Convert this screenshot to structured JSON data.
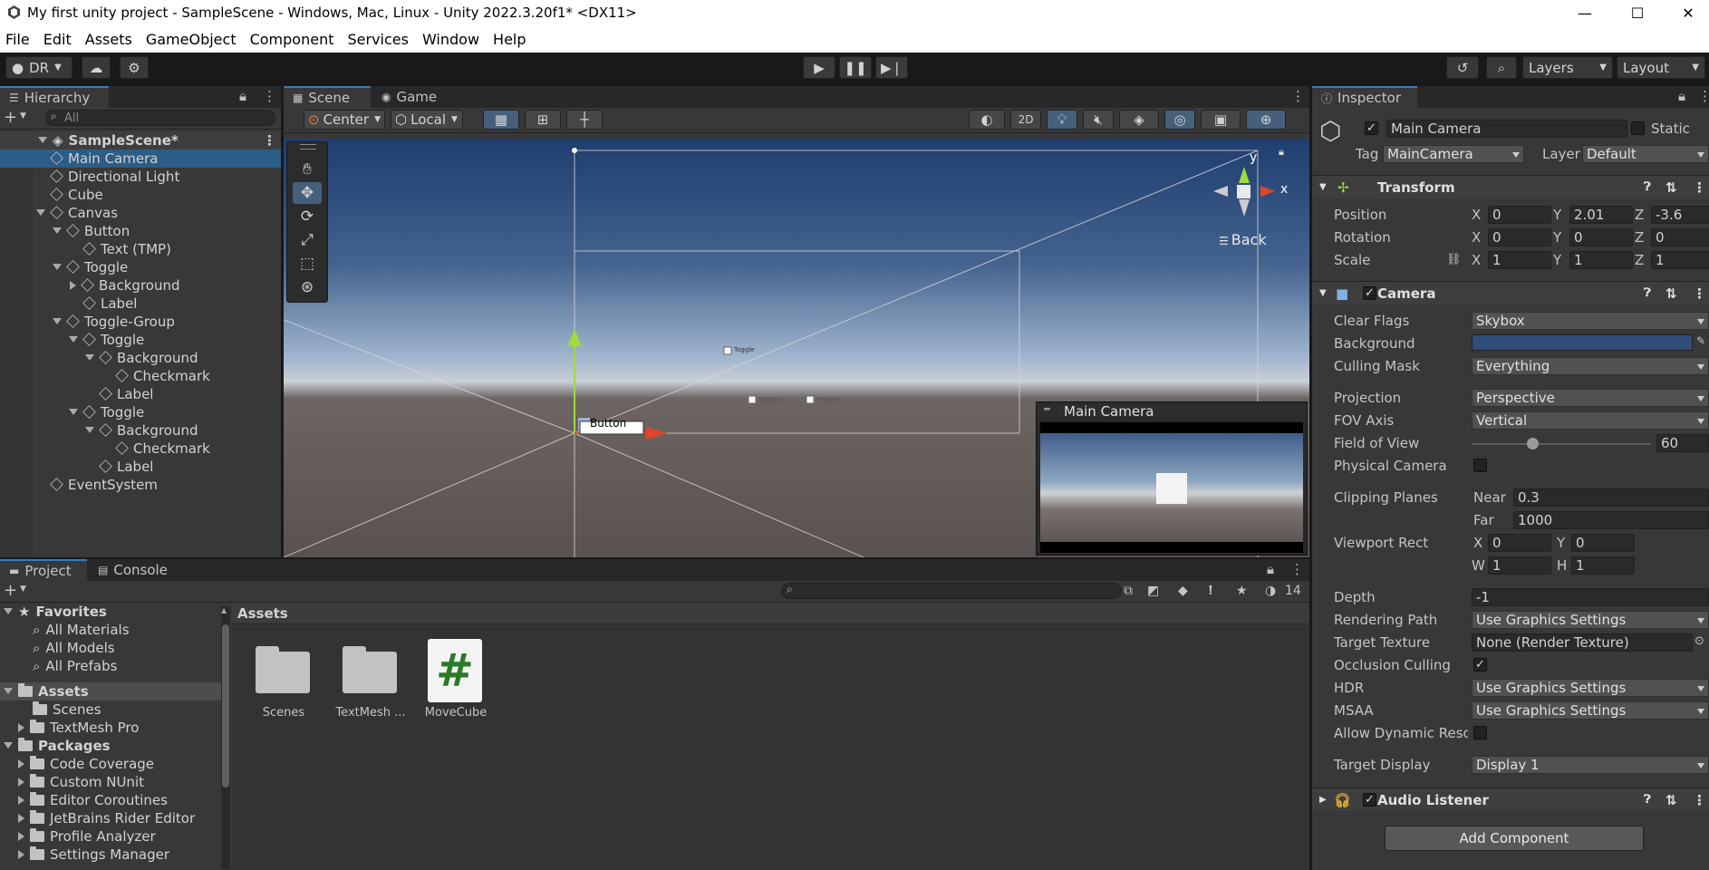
{
  "window": {
    "title": "My first unity project - SampleScene - Windows, Mac, Linux - Unity 2022.3.20f1* <DX11>"
  },
  "menu": [
    "File",
    "Edit",
    "Assets",
    "GameObject",
    "Component",
    "Services",
    "Window",
    "Help"
  ],
  "toolbar": {
    "account": "DR",
    "layers": "Layers",
    "layout": "Layout"
  },
  "hierarchy": {
    "tab": "Hierarchy",
    "search_placeholder": "All",
    "scene": "SampleScene*",
    "items": [
      {
        "label": "Main Camera",
        "depth": 1,
        "expand": "",
        "selected": true
      },
      {
        "label": "Directional Light",
        "depth": 1,
        "expand": ""
      },
      {
        "label": "Cube",
        "depth": 1,
        "expand": ""
      },
      {
        "label": "Canvas",
        "depth": 1,
        "expand": "open"
      },
      {
        "label": "Button",
        "depth": 2,
        "expand": "open"
      },
      {
        "label": "Text (TMP)",
        "depth": 3,
        "expand": ""
      },
      {
        "label": "Toggle",
        "depth": 2,
        "expand": "open"
      },
      {
        "label": "Background",
        "depth": 3,
        "expand": "closed"
      },
      {
        "label": "Label",
        "depth": 3,
        "expand": ""
      },
      {
        "label": "Toggle-Group",
        "depth": 2,
        "expand": "open"
      },
      {
        "label": "Toggle",
        "depth": 3,
        "expand": "open"
      },
      {
        "label": "Background",
        "depth": 4,
        "expand": "open"
      },
      {
        "label": "Checkmark",
        "depth": 5,
        "expand": ""
      },
      {
        "label": "Label",
        "depth": 4,
        "expand": ""
      },
      {
        "label": "Toggle",
        "depth": 3,
        "expand": "open"
      },
      {
        "label": "Background",
        "depth": 4,
        "expand": "open"
      },
      {
        "label": "Checkmark",
        "depth": 5,
        "expand": ""
      },
      {
        "label": "Label",
        "depth": 4,
        "expand": ""
      },
      {
        "label": "EventSystem",
        "depth": 1,
        "expand": ""
      }
    ]
  },
  "scene": {
    "tabs": [
      "Scene",
      "Game"
    ],
    "pivot": "Center",
    "space": "Local",
    "mode2d": "2D",
    "view_label": "Back",
    "button_label": "Button",
    "toggle_label": "Toggle",
    "toggle1": "Toggle1",
    "toggle2": "Toggle2",
    "axis_x": "x",
    "axis_y": "y",
    "preview_title": "Main Camera"
  },
  "project": {
    "tabs": [
      "Project",
      "Console"
    ],
    "hidden_count": "14",
    "favorites": {
      "label": "Favorites",
      "items": [
        "All Materials",
        "All Models",
        "All Prefabs"
      ]
    },
    "assets_root": {
      "label": "Assets",
      "items": [
        {
          "label": "Scenes",
          "expand": ""
        },
        {
          "label": "TextMesh Pro",
          "expand": "closed"
        }
      ]
    },
    "packages": {
      "label": "Packages",
      "items": [
        "Code Coverage",
        "Custom NUnit",
        "Editor Coroutines",
        "JetBrains Rider Editor",
        "Profile Analyzer",
        "Settings Manager"
      ]
    },
    "breadcrumb": "Assets",
    "grid": [
      {
        "label": "Scenes",
        "type": "folder"
      },
      {
        "label": "TextMesh ...",
        "type": "folder"
      },
      {
        "label": "MoveCube",
        "type": "script"
      }
    ]
  },
  "inspector": {
    "tab": "Inspector",
    "name": "Main Camera",
    "static": "Static",
    "tag_label": "Tag",
    "tag": "MainCamera",
    "layer_label": "Layer",
    "layer": "Default",
    "transform": {
      "title": "Transform",
      "position": {
        "label": "Position",
        "x": "0",
        "y": "2.01",
        "z": "-3.6"
      },
      "rotation": {
        "label": "Rotation",
        "x": "0",
        "y": "0",
        "z": "0"
      },
      "scale": {
        "label": "Scale",
        "x": "1",
        "y": "1",
        "z": "1"
      }
    },
    "camera": {
      "title": "Camera",
      "clear_flags": {
        "label": "Clear Flags",
        "value": "Skybox"
      },
      "background": {
        "label": "Background",
        "color": "#314d79"
      },
      "culling_mask": {
        "label": "Culling Mask",
        "value": "Everything"
      },
      "projection": {
        "label": "Projection",
        "value": "Perspective"
      },
      "fov_axis": {
        "label": "FOV Axis",
        "value": "Vertical"
      },
      "fov": {
        "label": "Field of View",
        "value": "60",
        "fraction": 0.34
      },
      "physical": {
        "label": "Physical Camera"
      },
      "clipping": {
        "label": "Clipping Planes",
        "near_label": "Near",
        "near": "0.3",
        "far_label": "Far",
        "far": "1000"
      },
      "viewport": {
        "label": "Viewport Rect",
        "x": "0",
        "y": "0",
        "w": "1",
        "h": "1"
      },
      "depth": {
        "label": "Depth",
        "value": "-1"
      },
      "rendering_path": {
        "label": "Rendering Path",
        "value": "Use Graphics Settings"
      },
      "target_texture": {
        "label": "Target Texture",
        "value": "None (Render Texture)"
      },
      "occlusion": {
        "label": "Occlusion Culling"
      },
      "hdr": {
        "label": "HDR",
        "value": "Use Graphics Settings"
      },
      "msaa": {
        "label": "MSAA",
        "value": "Use Graphics Settings"
      },
      "dynamic": {
        "label": "Allow Dynamic Resol"
      },
      "target_display": {
        "label": "Target Display",
        "value": "Display 1"
      }
    },
    "audio_listener": {
      "title": "Audio Listener"
    },
    "add_component": "Add Component",
    "axes": {
      "x": "X",
      "y": "Y",
      "z": "Z",
      "w": "W",
      "h": "H"
    }
  },
  "colors": {
    "selection": "#2c5d87",
    "accent": "#3a79bb"
  }
}
